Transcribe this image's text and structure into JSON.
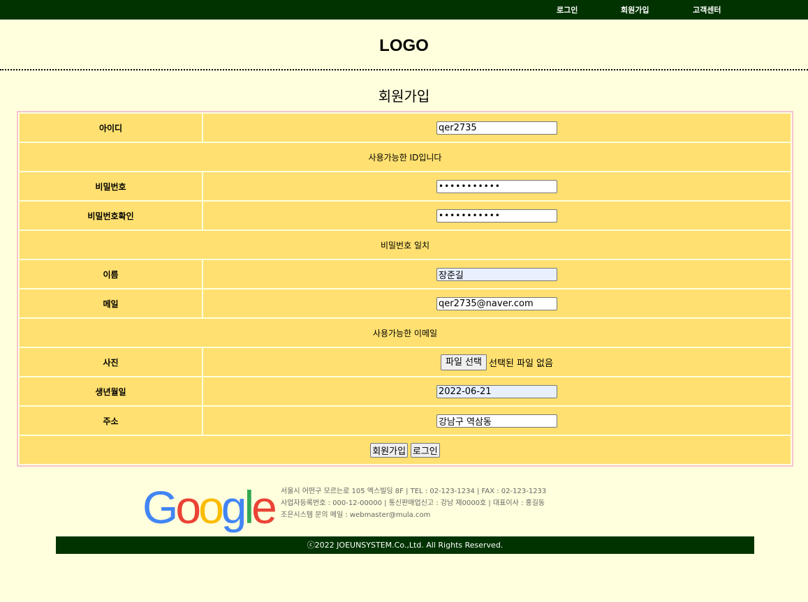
{
  "nav": {
    "login": "로그인",
    "join": "회원가입",
    "support": "고객센터"
  },
  "header": {
    "logo": "LOGO"
  },
  "form": {
    "title": "회원가입",
    "id_label": "아이디",
    "id_value": "qer2735",
    "id_msg": "사용가능한 ID입니다",
    "pw_label": "비밀번호",
    "pw_value": "•••••••••••",
    "pw_confirm_label": "비밀번호확인",
    "pw_confirm_value": "•••••••••••",
    "pw_msg": "비밀번호 일치",
    "name_label": "이름",
    "name_value": "장준길",
    "email_label": "메일",
    "email_value": "qer2735@naver.com",
    "email_msg": "사용가능한 이메일",
    "photo_label": "사진",
    "photo_button": "파일 선택",
    "photo_status": "선택된 파일 없음",
    "birth_label": "생년월일",
    "birth_value": "2022-06-21",
    "address_label": "주소",
    "address_value": "강남구 역삼동",
    "submit_label": "회원가입",
    "login_label": "로그인"
  },
  "footer": {
    "brand_letters": [
      "G",
      "o",
      "o",
      "g",
      "l",
      "e"
    ],
    "brand_colors": [
      "#4285F4",
      "#EA4335",
      "#FBBC05",
      "#4285F4",
      "#34A853",
      "#EA4335"
    ],
    "line1": "서울시 어떤구 모르는로 105 엑스빌딩 8F | TEL : 02-123-1234 | FAX : 02-123-1233",
    "line2": "사업자등록번호 : 000-12-00000 | 통신판매업신고 : 강남 제0000호 | 대표이사 : 홍길동",
    "line3": "조은시스템 문의 메일 : webmaster@mula.com",
    "copyright": "ⓒ2022 JOEUNSYSTEM.Co.,Ltd. All Rights Reserved."
  },
  "colors": {
    "topbar": "#003300",
    "background": "#ffffdd",
    "cell": "#ffe070",
    "table_border": "#f4c4d0"
  }
}
